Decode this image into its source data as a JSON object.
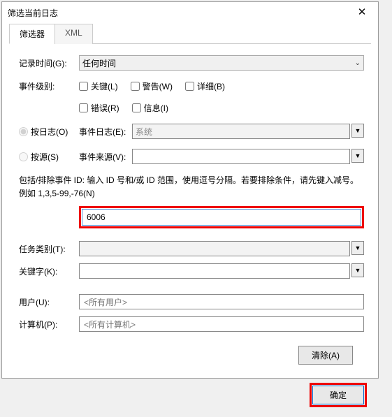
{
  "titlebar": {
    "title": "筛选当前日志",
    "close": "✕"
  },
  "tabs": {
    "filter": "筛选器",
    "xml": "XML"
  },
  "labels": {
    "logged": "记录时间(G):",
    "level": "事件级别:",
    "bylog": "按日志(O)",
    "bysource": "按源(S)",
    "eventlog": "事件日志(E):",
    "eventsource": "事件来源(V):",
    "task": "任务类别(T):",
    "keyword": "关键字(K):",
    "user": "用户(U):",
    "computer": "计算机(P):"
  },
  "values": {
    "logged_selected": "任何时间",
    "eventlog_selected": "系统",
    "eventsource_selected": "",
    "id_value": "6006",
    "task_selected": "",
    "keyword_selected": "",
    "user_value": "<所有用户>",
    "computer_value": "<所有计算机>"
  },
  "checkboxes": {
    "critical": "关键(L)",
    "warning": "警告(W)",
    "verbose": "详细(B)",
    "error": "错误(R)",
    "info": "信息(I)"
  },
  "hint": "包括/排除事件 ID: 输入 ID 号和/或 ID 范围，使用逗号分隔。若要排除条件，请先键入减号。例如 1,3,5-99,-76(N)",
  "buttons": {
    "clear": "清除(A)",
    "ok": "确定"
  }
}
